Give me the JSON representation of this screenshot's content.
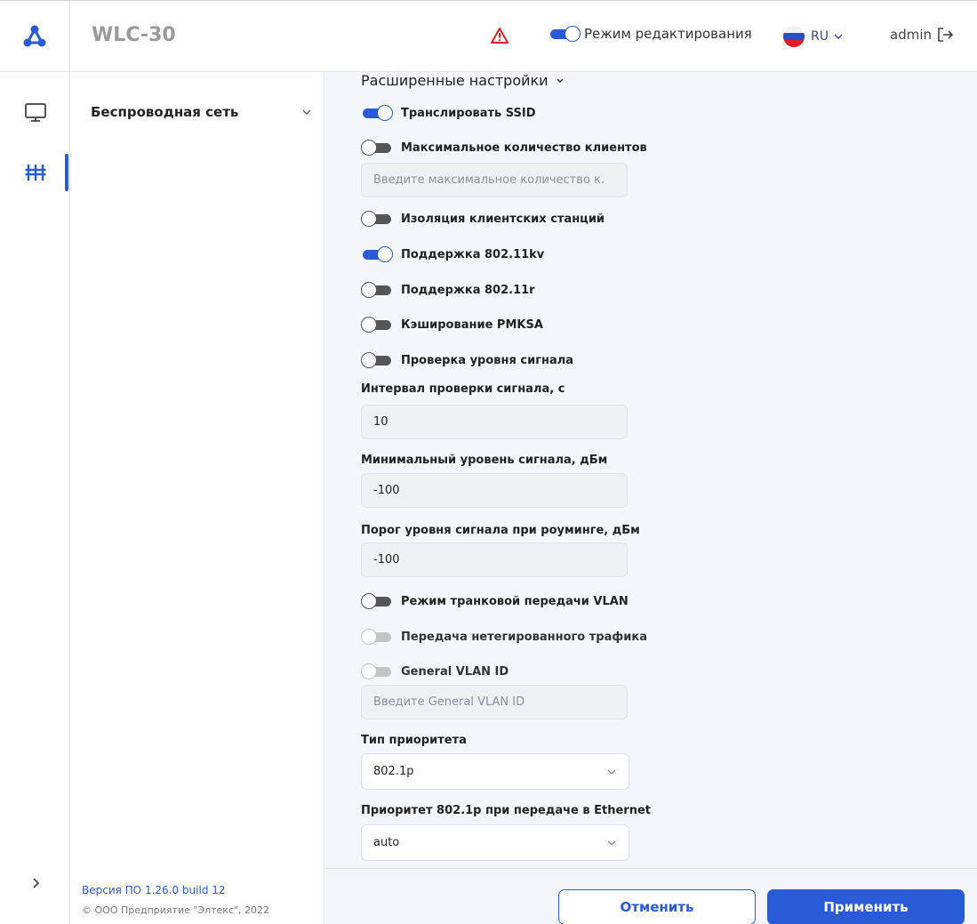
{
  "header": {
    "app_title": "WLC-30",
    "edit_mode_label": "Режим редактирования",
    "language": "RU",
    "user": "admin"
  },
  "sidebar": {
    "items": [
      {
        "label": "Беспроводная сеть"
      }
    ],
    "version": "Версия ПО 1.26.0 build 12",
    "copyright": "© ООО Предприятие \"Элтекс\", 2022"
  },
  "main": {
    "section_title": "Расширенные настройки",
    "broadcast_ssid": {
      "label": "Транслировать SSID",
      "state": "on"
    },
    "max_clients": {
      "label": "Максимальное количество клиентов",
      "state": "off",
      "placeholder": "Введите максимальное количество к."
    },
    "client_isolation": {
      "label": "Изоляция клиентских станций",
      "state": "off"
    },
    "support_80211kv": {
      "label": "Поддержка 802.11kv",
      "state": "on"
    },
    "support_80211r": {
      "label": "Поддержка 802.11r",
      "state": "off"
    },
    "pmksa_caching": {
      "label": "Кэширование PMKSA",
      "state": "off"
    },
    "signal_check": {
      "label": "Проверка уровня сигнала",
      "state": "off"
    },
    "signal_interval": {
      "label": "Интервал проверки сигнала, с",
      "value": "10"
    },
    "min_signal": {
      "label": "Минимальный уровень сигнала, дБм",
      "value": "-100"
    },
    "roaming_threshold": {
      "label": "Порог уровня сигнала при роуминге, дБм",
      "value": "-100"
    },
    "vlan_trunk": {
      "label": "Режим транковой передачи VLAN",
      "state": "off"
    },
    "untagged_traffic": {
      "label": "Передача нетегированного трафика",
      "state": "disabled"
    },
    "general_vlan": {
      "label": "General VLAN ID",
      "state": "disabled",
      "placeholder": "Введите General VLAN ID"
    },
    "priority_type": {
      "label": "Тип приоритета",
      "value": "802.1p"
    },
    "priority_8021p": {
      "label": "Приоритет 802.1p при передаче в Ethernet",
      "value": "auto"
    }
  },
  "actions": {
    "cancel_label": "Отменить",
    "apply_label": "Применить"
  },
  "colors": {
    "accent": "#2a5bd7",
    "warning": "#e02020",
    "background": "#f3f6fb"
  }
}
